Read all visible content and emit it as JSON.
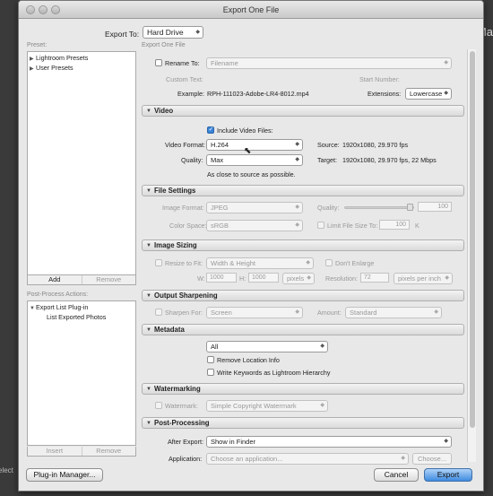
{
  "window": {
    "title": "Export One File"
  },
  "background": {
    "right_edge": "Ma",
    "left_edge": "elect"
  },
  "export_to": {
    "label": "Export To:",
    "value": "Hard Drive"
  },
  "left": {
    "preset_label": "Preset:",
    "presets": [
      "Lightroom Presets",
      "User Presets"
    ],
    "add_label": "Add",
    "remove_label": "Remove",
    "post_process_label": "Post-Process Actions:",
    "pp_items": [
      "Export List Plug-in",
      "List Exported Photos"
    ],
    "insert_label": "Insert",
    "remove2_label": "Remove"
  },
  "right": {
    "header": "Export One File",
    "file_naming": {
      "rename_label": "Rename To:",
      "rename_value": "Filename",
      "custom_text_label": "Custom Text:",
      "start_number_label": "Start Number:",
      "example_label": "Example:",
      "example_value": "RPH-111023-Adobe-LR4-8012.mp4",
      "extensions_label": "Extensions:",
      "extensions_value": "Lowercase"
    },
    "video": {
      "title": "Video",
      "include_label": "Include Video Files:",
      "format_label": "Video Format:",
      "format_value": "H.264",
      "quality_label": "Quality:",
      "quality_value": "Max",
      "source_label": "Source:",
      "source_value": "1920x1080, 29.970 fps",
      "target_label": "Target:",
      "target_value": "1920x1080, 29.970 fps, 22 Mbps",
      "note": "As close to source as possible."
    },
    "file_settings": {
      "title": "File Settings",
      "format_label": "Image Format:",
      "format_value": "JPEG",
      "quality_label": "Quality:",
      "quality_value": "100",
      "quality_level": 1.0,
      "space_label": "Color Space:",
      "space_value": "sRGB",
      "limit_label": "Limit File Size To:",
      "limit_value": "100",
      "limit_unit": "K"
    },
    "image_sizing": {
      "title": "Image Sizing",
      "resize_label": "Resize to Fit:",
      "resize_value": "Width & Height",
      "enlarge_label": "Don't Enlarge",
      "w_label": "W:",
      "w_value": "1000",
      "h_label": "H:",
      "h_value": "1000",
      "unit_value": "pixels",
      "res_label": "Resolution:",
      "res_value": "72",
      "res_unit": "pixels per inch"
    },
    "sharpening": {
      "title": "Output Sharpening",
      "sharpen_label": "Sharpen For:",
      "sharpen_value": "Screen",
      "amount_label": "Amount:",
      "amount_value": "Standard"
    },
    "metadata": {
      "title": "Metadata",
      "value": "All",
      "remove_loc": "Remove Location Info",
      "write_kw": "Write Keywords as Lightroom Hierarchy"
    },
    "watermarking": {
      "title": "Watermarking",
      "label": "Watermark:",
      "value": "Simple Copyright Watermark"
    },
    "post_processing": {
      "title": "Post-Processing",
      "after_label": "After Export:",
      "after_value": "Show in Finder",
      "app_label": "Application:",
      "app_value": "Choose an application...",
      "choose_label": "Choose..."
    }
  },
  "footer": {
    "plugin_manager": "Plug-in Manager...",
    "cancel": "Cancel",
    "export": "Export"
  }
}
